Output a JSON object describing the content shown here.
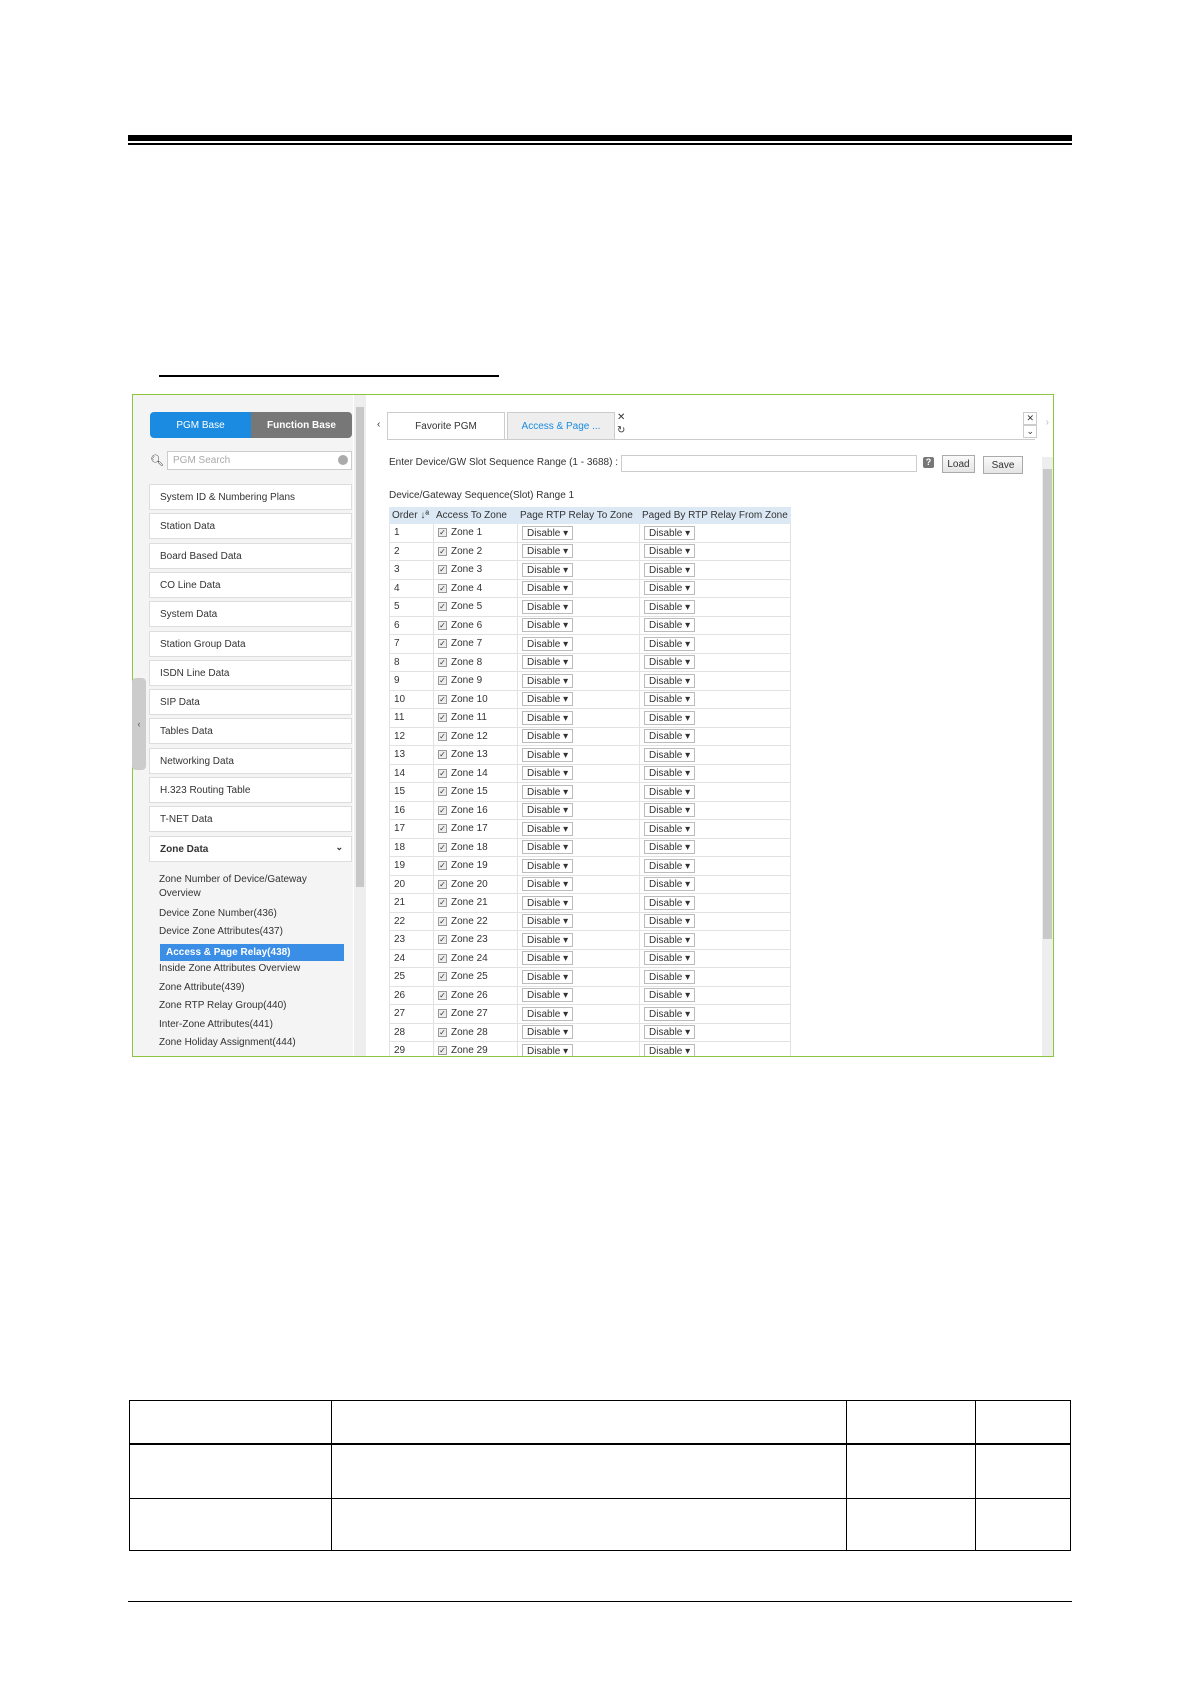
{
  "sidebar": {
    "mode_tabs": [
      "PGM Base",
      "Function Base"
    ],
    "search_placeholder": "PGM Search",
    "items": [
      "System ID & Numbering Plans",
      "Station Data",
      "Board Based Data",
      "CO Line Data",
      "System Data",
      "Station Group Data",
      "ISDN Line Data",
      "SIP Data",
      "Tables Data",
      "Networking Data",
      "H.323 Routing Table",
      "T-NET Data"
    ],
    "expanded": {
      "label": "Zone Data",
      "children": [
        "Zone Number of Device/Gateway Overview",
        "Device Zone Number(436)",
        "Device Zone Attributes(437)",
        "Access & Page Relay(438)",
        "Inside Zone Attributes Overview",
        "Zone Attribute(439)",
        "Zone RTP Relay Group(440)",
        "Inter-Zone Attributes(441)",
        "Zone Holiday Assignment(444)"
      ],
      "selected_index": 3
    }
  },
  "tabs": [
    {
      "label": "Favorite PGM",
      "active": false
    },
    {
      "label": "Access & Page ...",
      "active": true
    }
  ],
  "form": {
    "range_label": "Enter Device/GW Slot Sequence Range (1 - 3688) :",
    "range_value": "",
    "load_label": "Load",
    "save_label": "Save",
    "current_range": "Device/Gateway Sequence(Slot) Range 1"
  },
  "table": {
    "columns": [
      "Order ↓ª",
      "Access To Zone",
      "Page RTP Relay To Zone",
      "Paged By RTP Relay From Zone"
    ],
    "rows_count_visible": 29,
    "access_checked": true,
    "page_relay_value": "Disable",
    "paged_by_value": "Disable",
    "zone_prefix": "Zone"
  },
  "colors": {
    "accent": "#1a8be0",
    "selected": "#3a8ee6",
    "frame": "#8cc63f",
    "header": "#dce9f5"
  }
}
